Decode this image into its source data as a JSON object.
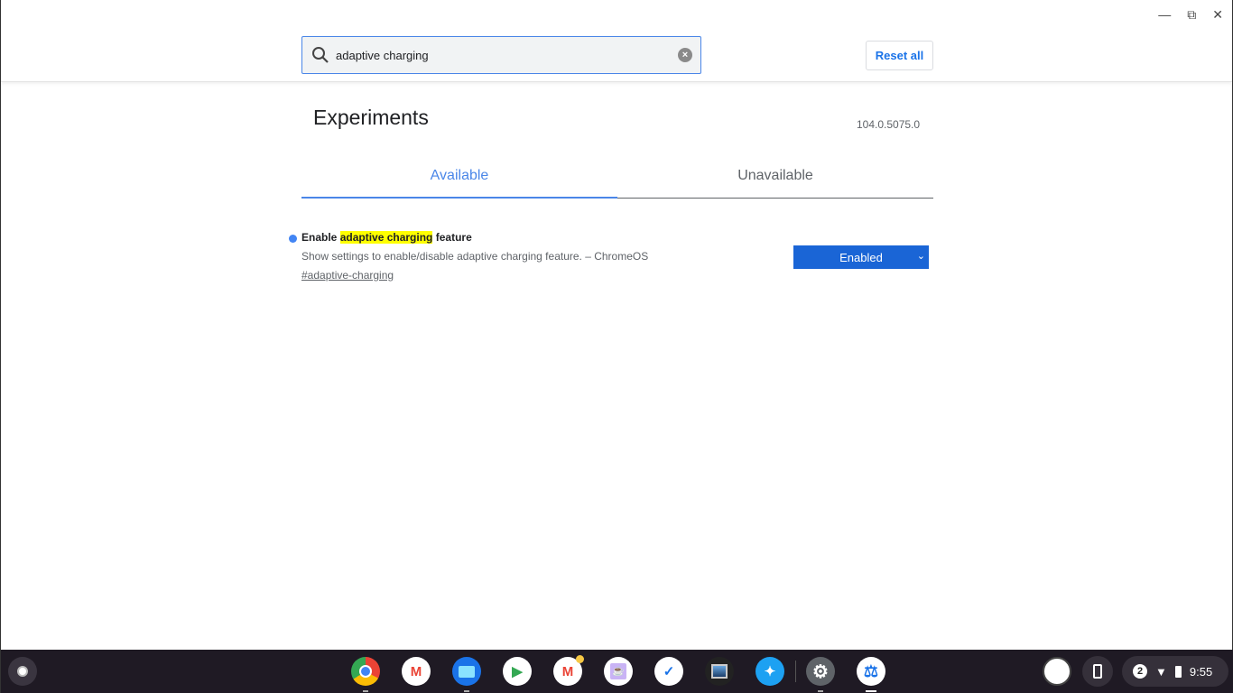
{
  "window": {
    "controls": [
      "minimize",
      "maximize",
      "close"
    ]
  },
  "search": {
    "value": "adaptive charging",
    "icon": "search-icon",
    "clear_icon": "clear-icon"
  },
  "reset_label": "Reset all",
  "title": "Experiments",
  "version": "104.0.5075.0",
  "tabs": [
    {
      "label": "Available",
      "active": true
    },
    {
      "label": "Unavailable",
      "active": false
    }
  ],
  "experiment": {
    "title_pre": "Enable ",
    "title_match": "adaptive charging",
    "title_post": " feature",
    "description": "Show settings to enable/disable adaptive charging feature. – ChromeOS",
    "link": "#adaptive-charging",
    "value": "Enabled"
  },
  "shelf": {
    "apps": [
      "Chrome",
      "Gmail",
      "Files",
      "Play Store",
      "Gmail (notification)",
      "Caffeine",
      "Google Tasks",
      "Photo Viewer",
      "Twitter",
      "Settings",
      "Chrome Flags"
    ]
  },
  "tray": {
    "notifications": "2",
    "time": "9:55"
  },
  "colors": {
    "accent": "#4a86e8",
    "select": "#1a65d6",
    "highlight": "#ffff00",
    "shelf": "#1f1a24"
  }
}
